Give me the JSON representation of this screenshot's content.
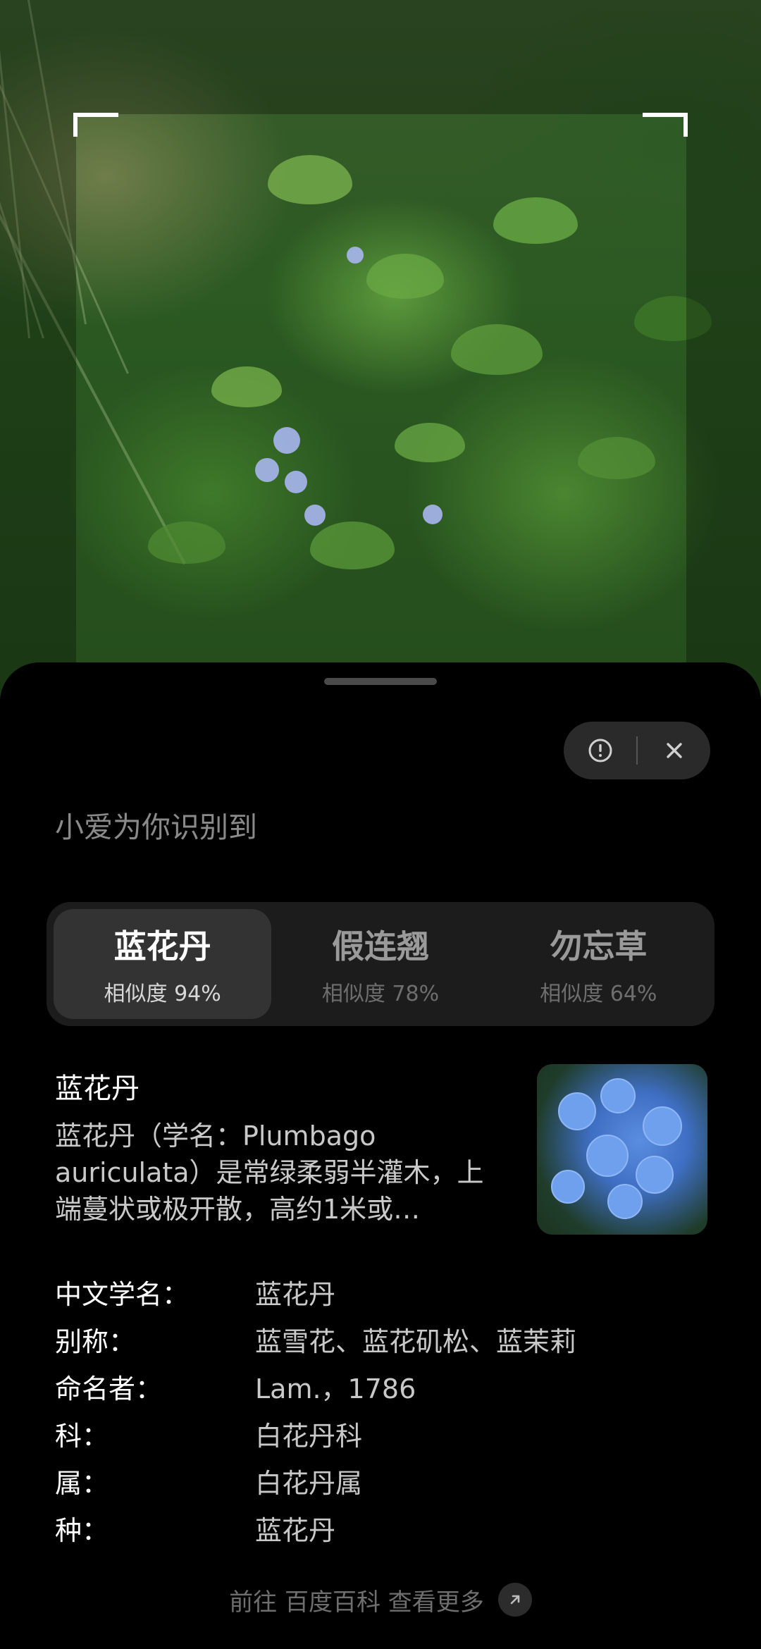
{
  "header": {
    "title": "小爱为你识别到"
  },
  "actions": {
    "report_icon": "alert-circle-icon",
    "close_icon": "close-icon"
  },
  "tabs": [
    {
      "name": "蓝花丹",
      "similarity": "相似度 94%",
      "active": true
    },
    {
      "name": "假连翘",
      "similarity": "相似度 78%",
      "active": false
    },
    {
      "name": "勿忘草",
      "similarity": "相似度 64%",
      "active": false
    }
  ],
  "detail": {
    "title": "蓝花丹",
    "description": "蓝花丹（学名：Plumbago auriculata）是常绿柔弱半灌木，上端蔓状或极开散，高约1米或…",
    "fields": [
      {
        "label": "中文学名：",
        "value": "蓝花丹"
      },
      {
        "label": "别称：",
        "value": "蓝雪花、蓝花矶松、蓝茉莉"
      },
      {
        "label": "命名者：",
        "value": "Lam.，1786"
      },
      {
        "label": "科：",
        "value": "白花丹科"
      },
      {
        "label": "属：",
        "value": "白花丹属"
      },
      {
        "label": "种：",
        "value": "蓝花丹"
      }
    ]
  },
  "footer": {
    "text": "前往 百度百科 查看更多",
    "icon": "arrow-up-right-icon"
  },
  "colors": {
    "sheet_bg": "#000000",
    "tab_active_bg": "#333333",
    "tab_bar_bg": "#1c1c1c"
  }
}
